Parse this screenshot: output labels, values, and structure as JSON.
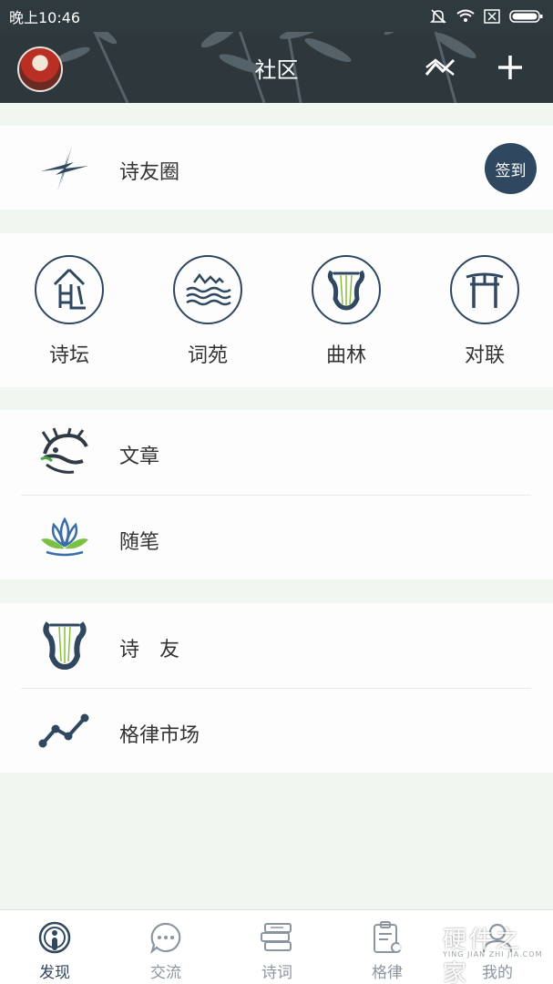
{
  "status_bar": {
    "time": "晚上10:46"
  },
  "header": {
    "title": "社区"
  },
  "friends_circle": {
    "label": "诗友圈",
    "checkin_label": "签到"
  },
  "grid": [
    {
      "label": "诗坛",
      "icon": "poetry-altar-icon"
    },
    {
      "label": "词苑",
      "icon": "waves-mountain-icon"
    },
    {
      "label": "曲林",
      "icon": "lyre-icon"
    },
    {
      "label": "对联",
      "icon": "gate-icon"
    }
  ],
  "list_1": [
    {
      "label": "文章",
      "icon": "dragon-icon"
    },
    {
      "label": "随笔",
      "icon": "lotus-icon"
    }
  ],
  "list_2": [
    {
      "label": "诗　友",
      "icon": "lyre-icon"
    },
    {
      "label": "格律市场",
      "icon": "trend-line-icon"
    }
  ],
  "tabs": [
    {
      "label": "发现",
      "icon": "discover-icon",
      "active": true
    },
    {
      "label": "交流",
      "icon": "chat-icon",
      "active": false
    },
    {
      "label": "诗词",
      "icon": "books-icon",
      "active": false
    },
    {
      "label": "格律",
      "icon": "clipboard-gear-icon",
      "active": false
    },
    {
      "label": "我的",
      "icon": "user-icon",
      "active": false
    }
  ],
  "watermark": {
    "text": "硬件之家",
    "sub": "YING JIAN ZHI JIA.COM"
  },
  "colors": {
    "header_bg": "#2d373c",
    "accent": "#2f475f",
    "page_bg": "#f0f7f0"
  }
}
